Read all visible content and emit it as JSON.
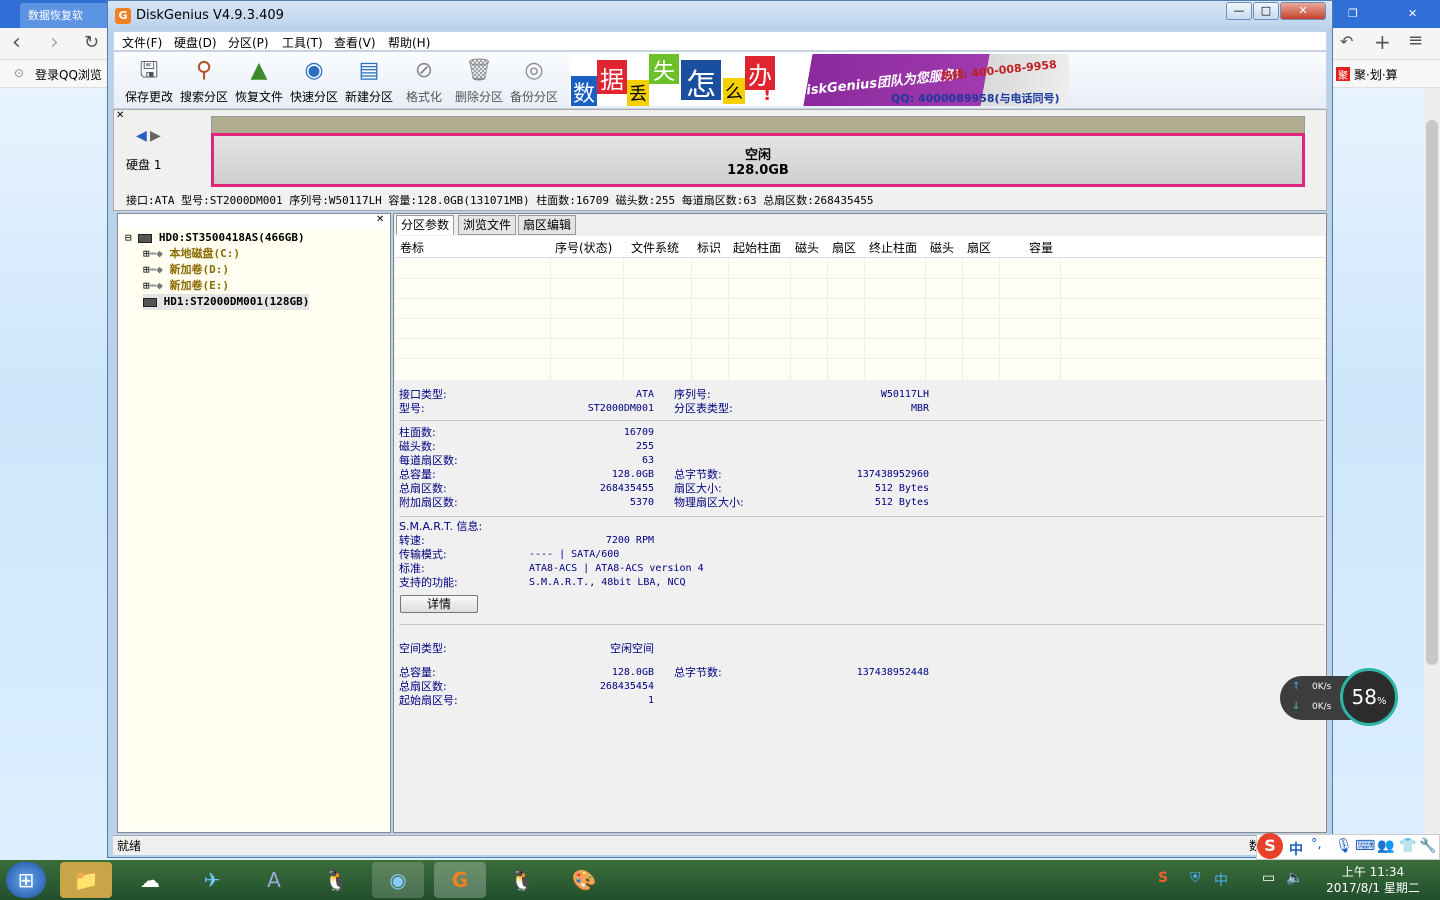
{
  "browser": {
    "tab1": "数据恢复软",
    "bookmark_left": "登录QQ浏览",
    "bookmark_right": "聚·划·算"
  },
  "window": {
    "title": "DiskGenius V4.9.3.409",
    "min": "—",
    "max": "□",
    "close": "✕"
  },
  "menu": [
    "文件(F)",
    "硬盘(D)",
    "分区(P)",
    "工具(T)",
    "查看(V)",
    "帮助(H)"
  ],
  "toolbar": [
    {
      "label": "保存更改",
      "icon": "save-icon"
    },
    {
      "label": "搜索分区",
      "icon": "search-icon"
    },
    {
      "label": "恢复文件",
      "icon": "recover-icon"
    },
    {
      "label": "快速分区",
      "icon": "quick-partition-icon"
    },
    {
      "label": "新建分区",
      "icon": "new-partition-icon"
    },
    {
      "label": "格式化",
      "icon": "format-icon"
    },
    {
      "label": "删除分区",
      "icon": "delete-icon"
    },
    {
      "label": "备份分区",
      "icon": "backup-icon"
    }
  ],
  "banner": {
    "chars": [
      "数",
      "据",
      "丢",
      "失",
      "怎",
      "么",
      "办",
      "!"
    ],
    "brand": "DiskGenius团队为您服务!",
    "phone": "热线: 400-008-9958",
    "qq": "QQ: 4000089958(与电话同号)"
  },
  "disk": {
    "label": "硬盘 1",
    "free_title": "空闲",
    "free_size": "128.0GB",
    "info": "接口:ATA  型号:ST2000DM001  序列号:W50117LH  容量:128.0GB(131071MB)  柱面数:16709  磁头数:255  每道扇区数:63  总扇区数:268435455"
  },
  "tree": [
    {
      "text": "HD0:ST3500418AS(466GB)",
      "color": "#000"
    },
    {
      "text": "本地磁盘(C:)",
      "color": "#8b6b00"
    },
    {
      "text": "新加卷(D:)",
      "color": "#8b6b00"
    },
    {
      "text": "新加卷(E:)",
      "color": "#8b6b00"
    },
    {
      "text": "HD1:ST2000DM001(128GB)",
      "color": "#000"
    }
  ],
  "tabs": [
    "分区参数",
    "浏览文件",
    "扇区编辑"
  ],
  "grid_headers": [
    "卷标",
    "序号(状态)",
    "文件系统",
    "标识",
    "起始柱面",
    "磁头",
    "扇区",
    "终止柱面",
    "磁头",
    "扇区",
    "容量"
  ],
  "info": {
    "iface_type_label": "接口类型:",
    "iface_type": "ATA",
    "model_label": "型号:",
    "model": "ST2000DM001",
    "serial_label": "序列号:",
    "serial": "W50117LH",
    "ptable_label": "分区表类型:",
    "ptable": "MBR",
    "cyl_label": "柱面数:",
    "cyl": "16709",
    "heads_label": "磁头数:",
    "heads": "255",
    "spt_label": "每道扇区数:",
    "spt": "63",
    "cap_label": "总容量:",
    "cap": "128.0GB",
    "bytes_label": "总字节数:",
    "bytes": "137438952960",
    "sectors_label": "总扇区数:",
    "sectors": "268435455",
    "secsize_label": "扇区大小:",
    "secsize": "512 Bytes",
    "extra_label": "附加扇区数:",
    "extra": "5370",
    "physsec_label": "物理扇区大小:",
    "physsec": "512 Bytes",
    "smart_label": "S.M.A.R.T. 信息:",
    "rpm_label": "转速:",
    "rpm": "7200 RPM",
    "mode_label": "传输模式:",
    "mode": "---- | SATA/600",
    "std_label": "标准:",
    "std": "ATA8-ACS | ATA8-ACS version 4",
    "feat_label": "支持的功能:",
    "feat": "S.M.A.R.T., 48bit LBA, NCQ",
    "detail_button": "详情",
    "space_type_label": "空间类型:",
    "space_type": "空闲空间",
    "scap_label": "总容量:",
    "scap": "128.0GB",
    "sbytes_label": "总字节数:",
    "sbytes": "137438952448",
    "ssectors_label": "总扇区数:",
    "ssectors": "268435454",
    "sstart_label": "起始扇区号:",
    "sstart": "1"
  },
  "status": "就绪",
  "status_right": "数",
  "speed": {
    "up": "0K/s",
    "down": "0K/s",
    "percent": "58",
    "unit": "%"
  },
  "clock": {
    "time": "上午 11:34",
    "date": "2017/8/1 星期二"
  },
  "ime": "中"
}
